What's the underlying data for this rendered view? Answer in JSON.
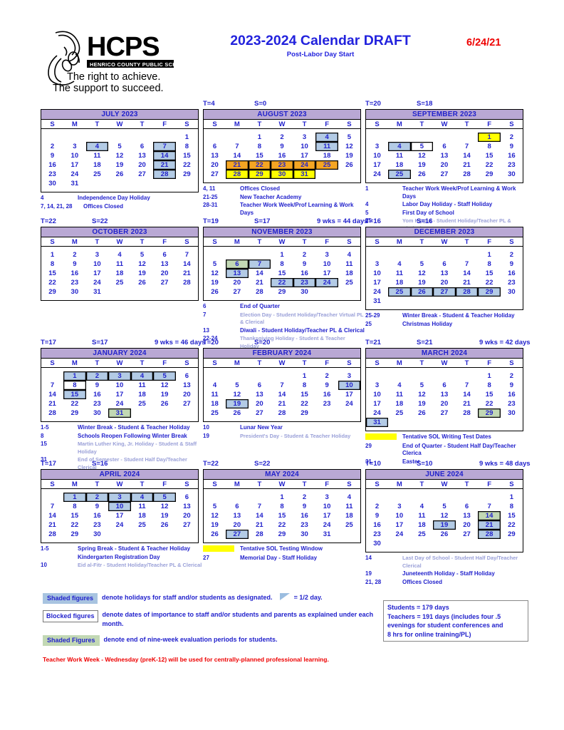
{
  "header": {
    "logo_text": "HCPS",
    "logo_sub": "HENRICO COUNTY PUBLIC SCHOOLS",
    "tagline1": "The right to achieve.",
    "tagline2": "The support to succeed.",
    "title": "2023-2024 Calendar DRAFT",
    "subtitle": "Post-Labor Day Start",
    "revision_date": "6/24/21"
  },
  "dow": [
    "S",
    "M",
    "T",
    "W",
    "T",
    "F",
    "S"
  ],
  "months": [
    {
      "name": "JULY 2023",
      "t": "",
      "s": "",
      "wks": "",
      "first_dow": 6,
      "days": 31,
      "cells": {
        "4": {
          "fill": "blue",
          "box": "full"
        },
        "7": {
          "fill": "blue",
          "box": "full"
        },
        "14": {
          "fill": "blue",
          "box": "full"
        },
        "21": {
          "fill": "blue",
          "box": "full"
        },
        "28": {
          "fill": "blue",
          "box": "full"
        }
      },
      "notes": [
        {
          "d": "4",
          "x": "Independence Day Holiday",
          "faint": false
        },
        {
          "d": "7, 14, 21, 28",
          "x": "Offices Closed",
          "faint": false,
          "wide": true
        }
      ]
    },
    {
      "name": "AUGUST 2023",
      "t": "T=4",
      "s": "S=0",
      "wks": "",
      "first_dow": 2,
      "days": 31,
      "cells": {
        "4": {
          "fill": "blue",
          "box": "full"
        },
        "11": {
          "fill": "blue",
          "box": "full"
        },
        "21": {
          "fill": "orange",
          "box": "full"
        },
        "22": {
          "fill": "orange",
          "box": "full"
        },
        "23": {
          "fill": "orange",
          "box": "full"
        },
        "24": {
          "fill": "orange",
          "box": "full"
        },
        "25": {
          "fill": "orange",
          "box": "full"
        },
        "28": {
          "fill": "yellow",
          "box": "full"
        },
        "29": {
          "fill": "yellow",
          "box": "full"
        },
        "30": {
          "fill": "yellow",
          "box": "full"
        },
        "31": {
          "fill": "yellow",
          "box": "full"
        }
      },
      "notes": [
        {
          "d": "4, 11",
          "x": "Offices Closed",
          "faint": false
        },
        {
          "d": "21-25",
          "x": "New Teacher Academy",
          "faint": false
        },
        {
          "d": "28-31",
          "x": "Teacher Work Week/Prof Learning & Work Days",
          "faint": false
        }
      ]
    },
    {
      "name": "SEPTEMBER 2023",
      "t": "T=20",
      "s": "S=18",
      "wks": "",
      "first_dow": 5,
      "days": 30,
      "cells": {
        "1": {
          "fill": "yellow",
          "box": "full"
        },
        "4": {
          "fill": "blue",
          "box": "full"
        },
        "5": {
          "fill": "white",
          "box": "full"
        },
        "25": {
          "fill": "blue",
          "box": "full"
        }
      },
      "notes": [
        {
          "d": "1",
          "x": "Teacher Work Week/Prof Learning & Work Days",
          "faint": false
        },
        {
          "d": "4",
          "x": "Labor Day Holiday - Staff Holiday",
          "faint": false
        },
        {
          "d": "5",
          "x": "First Day of School",
          "faint": false
        },
        {
          "d": "25",
          "x": "Yom Kippur - Student Holiday/Teacher PL & Clerical",
          "faint": true
        }
      ]
    },
    {
      "name": "OCTOBER 2023",
      "t": "T=22",
      "s": "S=22",
      "wks": "",
      "first_dow": 0,
      "days": 31,
      "cells": {},
      "notes": []
    },
    {
      "name": "NOVEMBER 2023",
      "t": "T=19",
      "s": "S=17",
      "wks": "9 wks = 44 days",
      "first_dow": 3,
      "days": 30,
      "cells": {
        "6": {
          "fill": "green",
          "box": "full"
        },
        "7": {
          "fill": "blue",
          "box": "full"
        },
        "13": {
          "fill": "blue",
          "box": "full"
        },
        "22": {
          "fill": "blue",
          "box": "full"
        },
        "23": {
          "fill": "blue",
          "box": "full"
        },
        "24": {
          "fill": "blue",
          "box": "full"
        }
      },
      "notes": [
        {
          "d": "6",
          "x": "End of Quarter",
          "faint": false
        },
        {
          "d": "7",
          "x": "Election Day - Student Holiday/Teacher Virtual PL & Clerical",
          "faint": true
        },
        {
          "d": "13",
          "x": "Diwali - Student Holiday/Teacher PL & Clerical",
          "faint": false
        },
        {
          "d": "22-24",
          "x": "Thanksgiving Holiday - Student & Teacher Holiday",
          "faint": true
        }
      ]
    },
    {
      "name": "DECEMBER 2023",
      "t": "T=16",
      "s": "S=16",
      "wks": "",
      "first_dow": 5,
      "days": 31,
      "cells": {
        "25": {
          "fill": "blue",
          "box": "full"
        },
        "26": {
          "fill": "blue",
          "box": "full"
        },
        "27": {
          "fill": "blue",
          "box": "full"
        },
        "28": {
          "fill": "blue",
          "box": "full"
        },
        "29": {
          "fill": "blue",
          "box": "full"
        }
      },
      "notes": [
        {
          "d": "25-29",
          "x": "Winter Break - Student & Teacher Holiday",
          "faint": false
        },
        {
          "d": "25",
          "x": "Christmas Holiday",
          "faint": false
        }
      ]
    },
    {
      "name": "JANUARY 2024",
      "t": "T=17",
      "s": "S=17",
      "wks": "9 wks = 46 days",
      "first_dow": 1,
      "days": 31,
      "cells": {
        "1": {
          "fill": "blue",
          "box": "full"
        },
        "2": {
          "fill": "blue",
          "box": "full"
        },
        "3": {
          "fill": "blue",
          "box": "full"
        },
        "4": {
          "fill": "blue",
          "box": "full"
        },
        "5": {
          "fill": "blue",
          "box": "full"
        },
        "8": {
          "fill": "white",
          "box": "full"
        },
        "15": {
          "fill": "blue",
          "box": "full"
        },
        "31": {
          "fill": "green",
          "box": "full"
        }
      },
      "notes": [
        {
          "d": "1-5",
          "x": "Winter Break - Student & Teacher Holiday",
          "faint": false
        },
        {
          "d": "8",
          "x": "Schools Reopen Following Winter Break",
          "faint": false
        },
        {
          "d": "15",
          "x": "Martin Luther King, Jr. Holiday - Student & Staff Holiday",
          "faint": true
        },
        {
          "d": "31",
          "x": "End of Semester - Student Half Day/Teacher Clerical",
          "faint": true
        }
      ]
    },
    {
      "name": "FEBRUARY 2024",
      "t": "T=20",
      "s": "S=20",
      "wks": "",
      "first_dow": 4,
      "days": 29,
      "cells": {
        "10": {
          "fill": "blue",
          "box": "full"
        },
        "19": {
          "fill": "blue",
          "box": "full"
        }
      },
      "notes": [
        {
          "d": "10",
          "x": "Lunar New Year",
          "faint": false
        },
        {
          "d": "19",
          "x": "President's Day - Student & Teacher Holiday",
          "faint": true
        }
      ]
    },
    {
      "name": "MARCH 2024",
      "t": "T=21",
      "s": "S=21",
      "wks": "9 wks = 42 days",
      "first_dow": 5,
      "days": 31,
      "cells": {
        "29": {
          "fill": "green",
          "box": "full"
        },
        "31": {
          "fill": "blue",
          "box": "full"
        }
      },
      "notes": [
        {
          "d": "__SWATCH_YELLOW__",
          "x": "Tentative SOL Writing Test Dates",
          "faint": false
        },
        {
          "d": "29",
          "x": "End of Quarter - Student Half Day/Teacher Clerica",
          "faint": false
        },
        {
          "d": "31",
          "x": "Easter",
          "faint": false
        }
      ]
    },
    {
      "name": "APRIL 2024",
      "t": "T=17",
      "s": "S=16",
      "wks": "",
      "first_dow": 1,
      "days": 30,
      "cells": {
        "1": {
          "fill": "blue",
          "box": "full"
        },
        "2": {
          "fill": "blue",
          "box": "full"
        },
        "3": {
          "fill": "blue",
          "box": "full"
        },
        "4": {
          "fill": "blue",
          "box": "full"
        },
        "5": {
          "fill": "blue",
          "box": "full"
        },
        "10": {
          "fill": "blue",
          "box": "full"
        }
      },
      "notes": [
        {
          "d": "1-5",
          "x": "Spring Break - Student & Teacher Holiday",
          "faint": false
        },
        {
          "d": "",
          "x": "Kindergarten Registration Day",
          "faint": false
        },
        {
          "d": "10",
          "x": "Eid al-Fitr - Student Holiday/Teacher PL & Clerical",
          "faint": true
        }
      ]
    },
    {
      "name": "MAY 2024",
      "t": "T=22",
      "s": "S=22",
      "wks": "",
      "first_dow": 3,
      "days": 31,
      "cells": {
        "27": {
          "fill": "blue",
          "box": "full"
        }
      },
      "notes": [
        {
          "d": "__SWATCH_YELLOW__",
          "x": "Tentative SOL Testing Window",
          "faint": false
        },
        {
          "d": "27",
          "x": "Memorial Day - Staff Holiday",
          "faint": false
        }
      ]
    },
    {
      "name": "JUNE 2024",
      "t": "T=10",
      "s": "S=10",
      "wks": "9 wks = 48 days",
      "first_dow": 6,
      "days": 30,
      "cells": {
        "14": {
          "fill": "green",
          "box": "full"
        },
        "19": {
          "fill": "blue",
          "box": "full"
        },
        "21": {
          "fill": "blue",
          "box": "full"
        },
        "28": {
          "fill": "blue",
          "box": "full"
        }
      },
      "notes": [
        {
          "d": "14",
          "x": "Last Day of School - Student Half Day/Teacher Clerical",
          "faint": true
        },
        {
          "d": "19",
          "x": "Juneteenth Holiday - Staff Holiday",
          "faint": false
        },
        {
          "d": "21, 28",
          "x": "Offices Closed",
          "faint": false
        }
      ]
    }
  ],
  "legend": {
    "shaded_blue_tag": "Shaded figures",
    "shaded_blue_text": "denote holidays for staff and/or students as designated.",
    "half_day_text": "= 1/2 day.",
    "blocked_tag": "Blocked figures",
    "blocked_text": "denote dates of importance to staff and/or students and parents as explained under each month.",
    "shaded_green_tag": "Shaded Figures",
    "shaded_green_text": "denote end of nine-week evaluation periods for students.",
    "teacher_note": "Teacher Work Week - Wednesday (preK-12) will be used for centrally-planned professional learning."
  },
  "summary": {
    "line1": "Students = 179 days",
    "line2": "Teachers = 191 days (includes four .5",
    "line3": "evenings for student conferences and",
    "line4": "8 hrs for online training/PL)"
  },
  "colors": {
    "blue_fill": "#b3cbe5",
    "orange_fill": "#f5a623",
    "yellow_fill": "#ffff00",
    "green_fill": "#c2d8b4",
    "month_header": "#b9a8d4",
    "text_blue": "#2222cc",
    "rev_red": "#ee0000"
  }
}
